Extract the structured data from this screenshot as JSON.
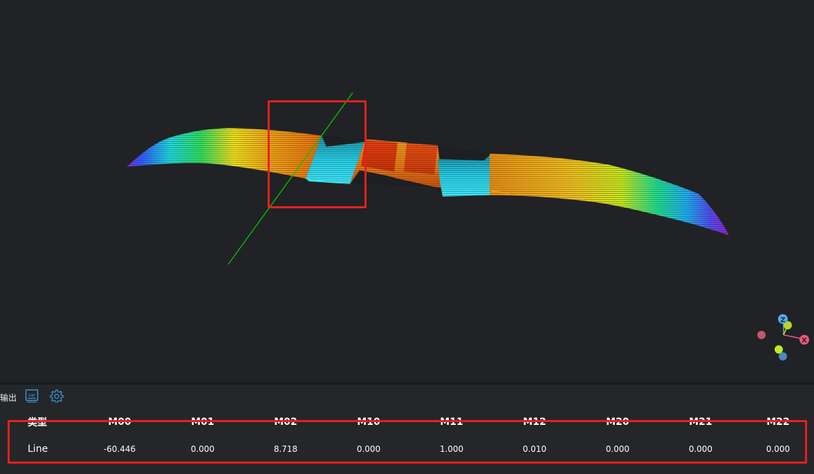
{
  "colors": {
    "background": "#212225",
    "panel": "#25262a",
    "highlight": "#e8201c",
    "axis_x": "#e85a77",
    "axis_y": "#c6e820",
    "axis_z": "#5aa8e8",
    "axis_line": "#00c800"
  },
  "gizmo": {
    "z_label": "Z",
    "x_label": "X"
  },
  "panel": {
    "tab_label": "输出",
    "toolbar": {
      "var_icon": "var-icon",
      "var_text": "var",
      "settings_icon": "gear-icon"
    }
  },
  "table": {
    "columns": [
      "类型",
      "M00",
      "M01",
      "M02",
      "M10",
      "M11",
      "M12",
      "M20",
      "M21",
      "M22"
    ],
    "rows": [
      {
        "cells": [
          "Line",
          "-60.446",
          "0.000",
          "8.718",
          "0.000",
          "1.000",
          "0.010",
          "0.000",
          "0.000",
          "0.000"
        ]
      }
    ]
  }
}
